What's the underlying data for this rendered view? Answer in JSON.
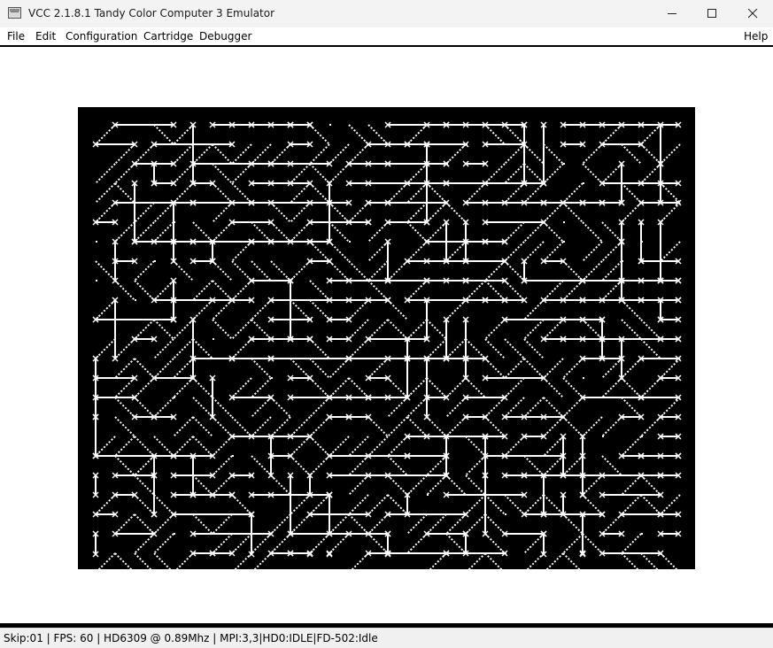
{
  "window": {
    "title": "VCC 2.1.8.1 Tandy Color Computer 3 Emulator",
    "icon": "app-window-icon",
    "controls": [
      "minimize-icon",
      "maximize-icon",
      "close-icon"
    ]
  },
  "menu": {
    "items": [
      "File",
      "Edit",
      "Configuration",
      "Cartridge",
      "Debugger"
    ],
    "help": "Help"
  },
  "emulator": {
    "screen_background": "#000000",
    "pattern_color": "#ffffff",
    "content": "maze-pattern"
  },
  "status": {
    "text": "Skip:01 | FPS: 60 | HD6309 @ 0.89Mhz | MPI:3,3|HD0:IDLE|FD-502:Idle"
  },
  "colors": {
    "titlebar": "#f3f3f3",
    "frame": "#000000",
    "statusbar": "#f0f0f0"
  }
}
